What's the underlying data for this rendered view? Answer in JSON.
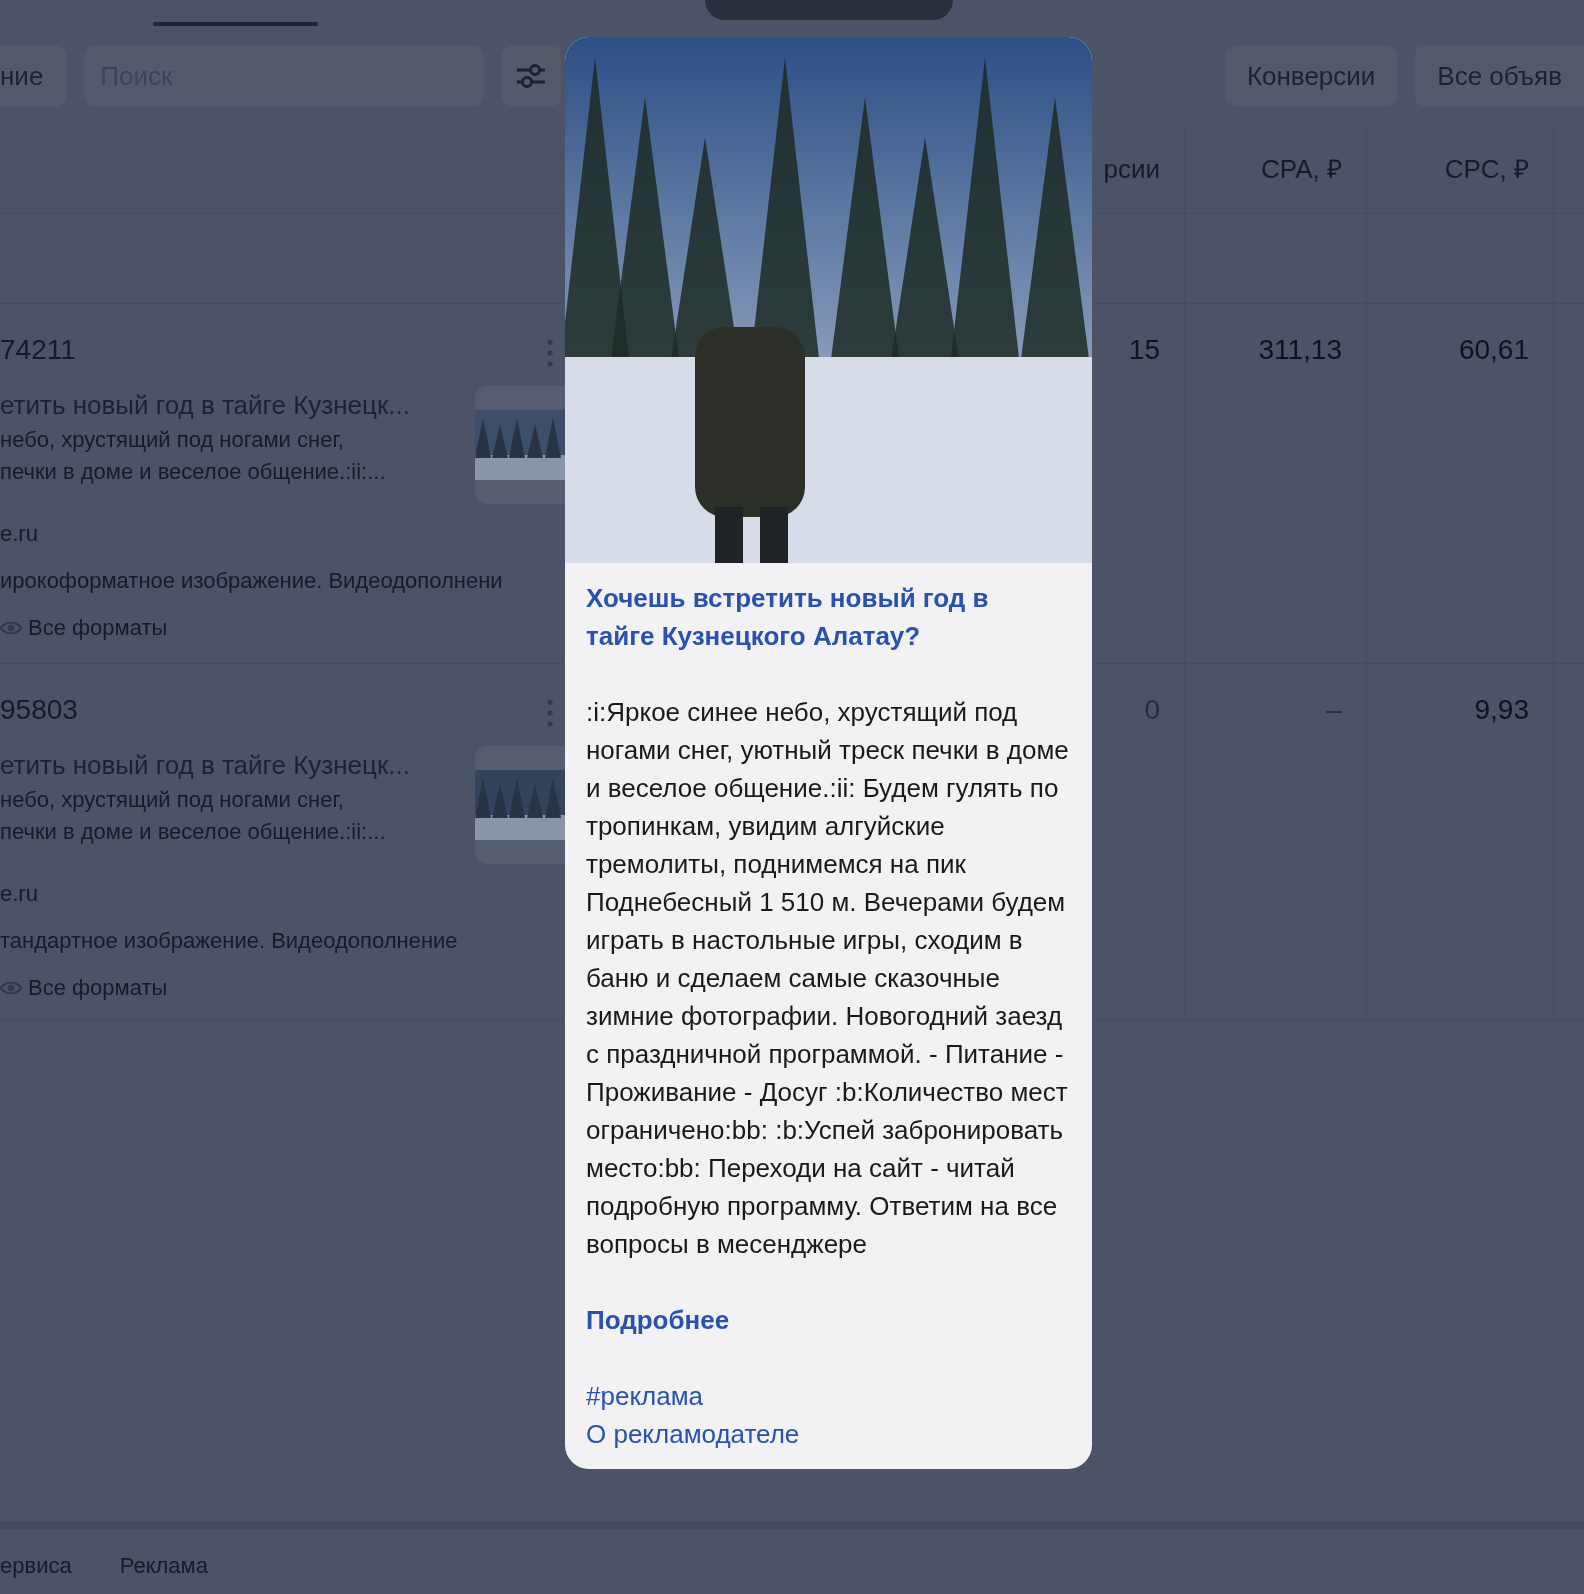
{
  "toolbar": {
    "chip": "ние",
    "search": {
      "placeholder": "Поиск"
    },
    "buttons": [
      "Конверсии",
      "Все объяв"
    ]
  },
  "table": {
    "columns": [
      "рсии",
      "CPA, ₽",
      "CPC, ₽"
    ],
    "rows": [
      {
        "id": "74211",
        "title": "етить новый год в тайге Кузнецк...",
        "description_lines": [
          "небо, хрустящий под ногами снег,",
          "печки в доме и веселое общение.:ii:..."
        ],
        "domain": "e.ru",
        "formats": "ирокоформатное изображение. Видеодополнени",
        "formats_link": "Все форматы",
        "metrics": [
          {
            "value": "15",
            "muted": false
          },
          {
            "value": "311,13",
            "muted": false
          },
          {
            "value": "60,61",
            "muted": false
          }
        ]
      },
      {
        "id": "95803",
        "title": "етить новый год в тайге Кузнецк...",
        "description_lines": [
          "небо, хрустящий под ногами снег,",
          "печки в доме и веселое общение.:ii:..."
        ],
        "domain": "e.ru",
        "formats": "тандартное изображение. Видеодополнение",
        "formats_link": "Все форматы",
        "metrics": [
          {
            "value": "0",
            "muted": true
          },
          {
            "value": "–",
            "muted": true
          },
          {
            "value": "9,93",
            "muted": false
          }
        ]
      }
    ]
  },
  "footer": [
    "ервиса",
    "Реклама"
  ],
  "ad_preview": {
    "title": "Хочешь встретить новый год в тайге Кузнецкого Алатау?",
    "body": ":i:Яркое синее небо, хрустящий под ногами снег, уютный треск печки в доме и веселое общение.:ii: Будем гулять по тропинкам, увидим алгуйские тремолиты, поднимемся на пик Поднебесный 1 510 м. Вечерами будем играть в настольные игры, сходим в баню и сделаем самые сказочные зимние фотографии. Новогодний заезд с праздничной программой. - Питание - Проживание - Досуг :b:Количество мест ограничено:bb: :b:Успей забронировать место:bb: Переходи на сайт - читай подробную программу. Ответим на все вопросы в месенджере",
    "more_link": "Подробнее",
    "footer_links": [
      "#реклама",
      "О рекламодателе"
    ]
  }
}
